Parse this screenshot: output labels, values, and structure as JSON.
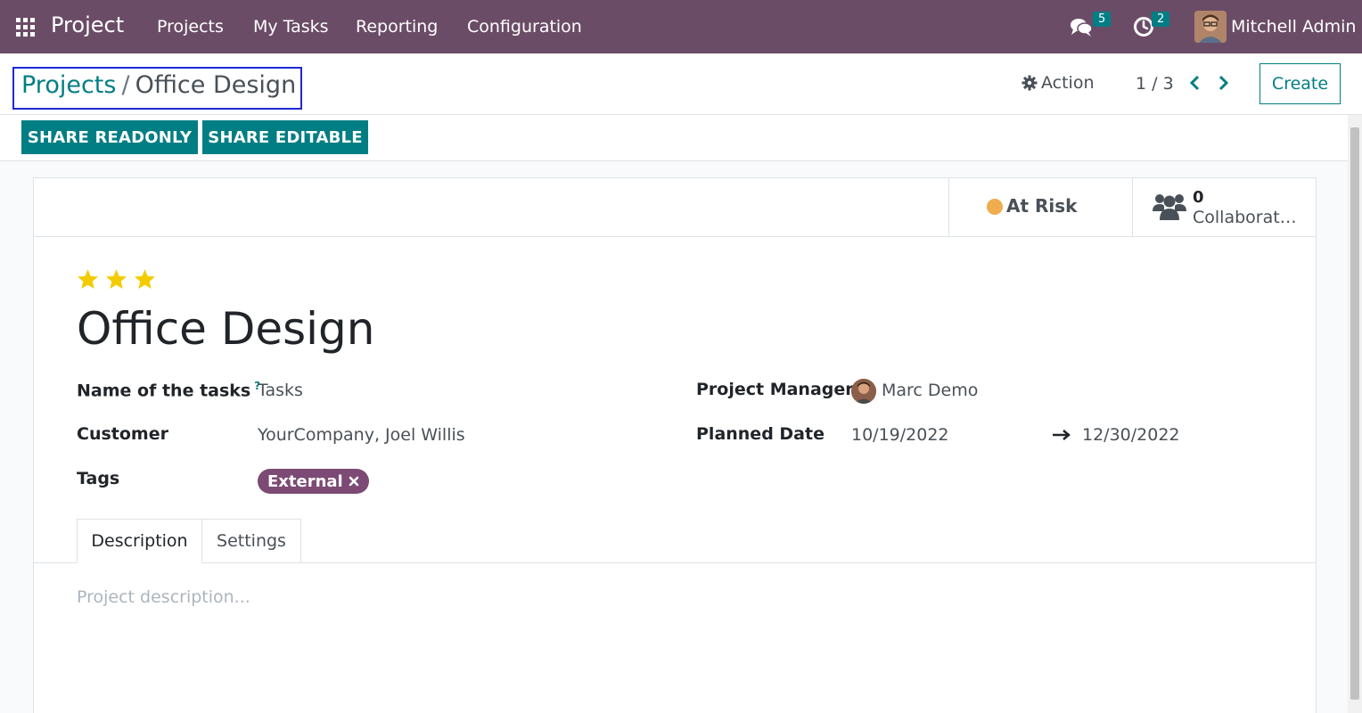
{
  "navbar": {
    "brand": "Project",
    "menu": [
      "Projects",
      "My Tasks",
      "Reporting",
      "Configuration"
    ],
    "messages_count": "5",
    "activities_count": "2",
    "user_name": "Mitchell Admin"
  },
  "control_panel": {
    "breadcrumb_parent": "Projects",
    "breadcrumb_separator": "/",
    "breadcrumb_current": "Office Design",
    "action_label": "Action",
    "pager": "1 / 3",
    "create_label": "Create",
    "share_readonly": "SHARE READONLY",
    "share_editable": "SHARE EDITABLE"
  },
  "stat_buttons": {
    "status": "At Risk",
    "status_color": "#f0ad4e",
    "collaborators_count": "0",
    "collaborators_label": "Collaborat…"
  },
  "form": {
    "priority_stars": 3,
    "title": "Office Design",
    "name_of_tasks_label": "Name of the tasks",
    "help_mark": "?",
    "name_of_tasks_value": "Tasks",
    "customer_label": "Customer",
    "customer_value": "YourCompany, Joel Willis",
    "tags_label": "Tags",
    "tag": "External",
    "project_manager_label": "Project Manager",
    "project_manager_value": "Marc Demo",
    "planned_date_label": "Planned Date",
    "planned_date_start": "10/19/2022",
    "planned_date_end": "12/30/2022"
  },
  "tabs": [
    "Description",
    "Settings"
  ],
  "description_placeholder": "Project description..."
}
